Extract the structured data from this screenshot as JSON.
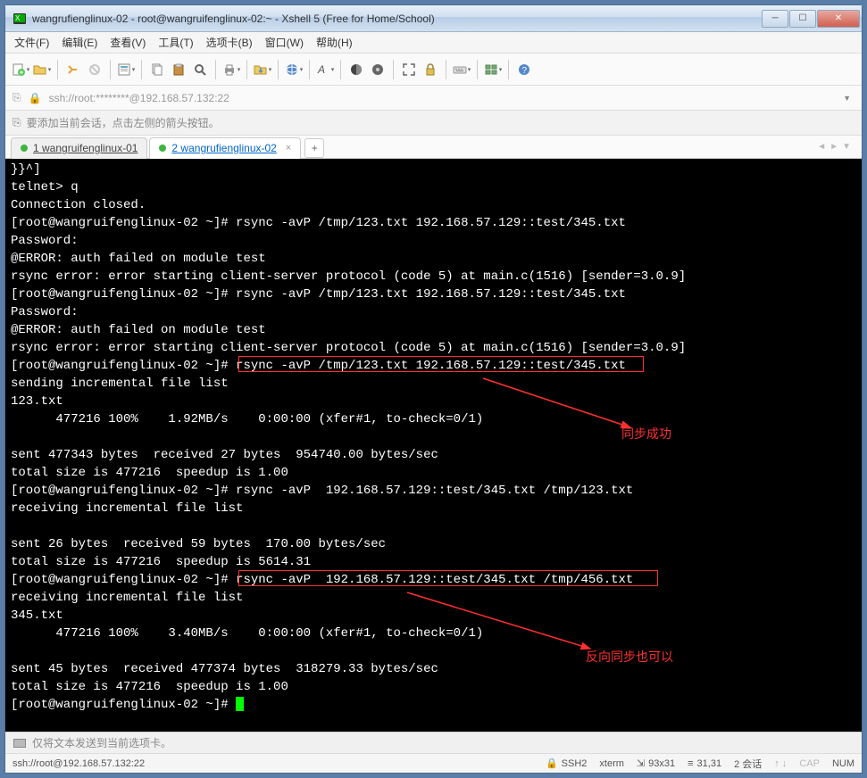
{
  "window": {
    "title": "wangrufienglinux-02 - root@wangruifenglinux-02:~ - Xshell 5 (Free for Home/School)"
  },
  "menu": {
    "file": "文件(F)",
    "edit": "编辑(E)",
    "view": "查看(V)",
    "tools": "工具(T)",
    "optionstab": "选项卡(B)",
    "window": "窗口(W)",
    "help": "帮助(H)"
  },
  "addressbar": {
    "text": "ssh://root:********@192.168.57.132:22"
  },
  "tipbar": {
    "text": "要添加当前会话，点击左侧的箭头按钮。"
  },
  "tabs": {
    "tab1": "1 wangruifenglinux-01",
    "tab2": "2 wangrufienglinux-02",
    "plus": "+"
  },
  "terminal_lines": [
    "}}^]",
    "telnet> q",
    "Connection closed.",
    "[root@wangruifenglinux-02 ~]# rsync -avP /tmp/123.txt 192.168.57.129::test/345.txt",
    "Password:",
    "@ERROR: auth failed on module test",
    "rsync error: error starting client-server protocol (code 5) at main.c(1516) [sender=3.0.9]",
    "[root@wangruifenglinux-02 ~]# rsync -avP /tmp/123.txt 192.168.57.129::test/345.txt",
    "Password:",
    "@ERROR: auth failed on module test",
    "rsync error: error starting client-server protocol (code 5) at main.c(1516) [sender=3.0.9]",
    "[root@wangruifenglinux-02 ~]# rsync -avP /tmp/123.txt 192.168.57.129::test/345.txt",
    "sending incremental file list",
    "123.txt",
    "      477216 100%    1.92MB/s    0:00:00 (xfer#1, to-check=0/1)",
    "",
    "sent 477343 bytes  received 27 bytes  954740.00 bytes/sec",
    "total size is 477216  speedup is 1.00",
    "[root@wangruifenglinux-02 ~]# rsync -avP  192.168.57.129::test/345.txt /tmp/123.txt",
    "receiving incremental file list",
    "",
    "sent 26 bytes  received 59 bytes  170.00 bytes/sec",
    "total size is 477216  speedup is 5614.31",
    "[root@wangruifenglinux-02 ~]# rsync -avP  192.168.57.129::test/345.txt /tmp/456.txt",
    "receiving incremental file list",
    "345.txt",
    "      477216 100%    3.40MB/s    0:00:00 (xfer#1, to-check=0/1)",
    "",
    "sent 45 bytes  received 477374 bytes  318279.33 bytes/sec",
    "total size is 477216  speedup is 1.00",
    "[root@wangruifenglinux-02 ~]# "
  ],
  "annotations": {
    "label1": "同步成功",
    "label2": "反向同步也可以"
  },
  "bottombar": {
    "text": "仅将文本发送到当前选项卡。"
  },
  "status": {
    "conn": "ssh://root@192.168.57.132:22",
    "ssh": "SSH2",
    "term": "xterm",
    "size": "93x31",
    "pos": "31,31",
    "sessions": "2 会话",
    "cap": "CAP",
    "num": "NUM"
  }
}
